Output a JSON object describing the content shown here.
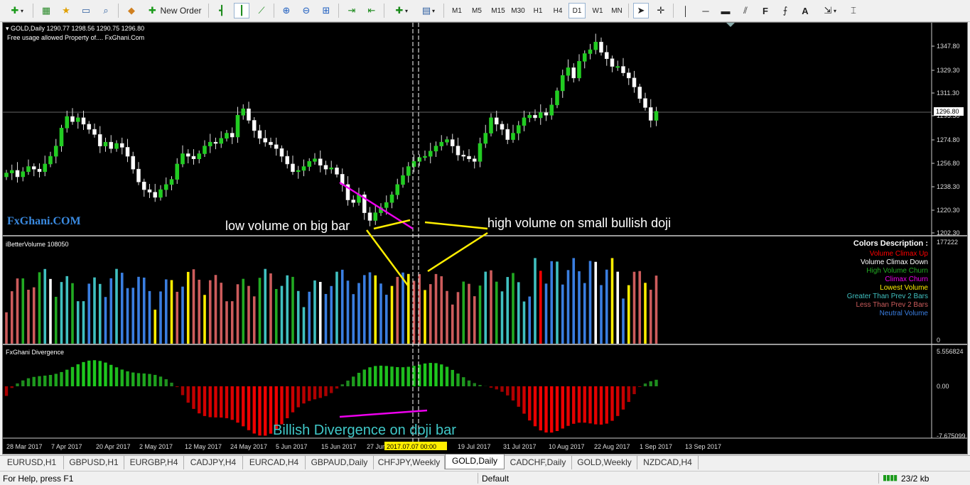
{
  "toolbar": {
    "new_order_label": "New Order",
    "timeframes": [
      "M1",
      "M5",
      "M15",
      "M30",
      "H1",
      "H4",
      "D1",
      "W1",
      "MN"
    ],
    "active_timeframe": "D1"
  },
  "chart": {
    "symbol_line": "GOLD,Daily  1290.77 1298.56 1290.75 1296.80",
    "usage_line": "Free usage allowed Property of.... FxGhani.Com",
    "watermark": "FxGhani.COM",
    "price_ticks": [
      "1347.80",
      "1329.30",
      "1311.30",
      "1293.30",
      "1274.80",
      "1256.80",
      "1238.30",
      "1220.30",
      "1202.30"
    ],
    "current_price": "1296.80",
    "volume_indicator": "iBetterVolume 108050",
    "volume_max": "177222",
    "volume_min": "0",
    "divergence_indicator": "FxGhani Divergence",
    "divergence_ticks": [
      "5.556824",
      "0.00",
      "-7.675099"
    ],
    "date_ticks": [
      "28 Mar 2017",
      "7 Apr 2017",
      "20 Apr 2017",
      "2 May 2017",
      "12 May 2017",
      "24 May 2017",
      "5 Jun 2017",
      "15 Jun 2017",
      "27 Jun 2017",
      "19 Jul 2017",
      "31 Jul 2017",
      "10 Aug 2017",
      "22 Aug 2017",
      "1 Sep 2017",
      "13 Sep 2017"
    ],
    "cursor_date": "2017.07.07 00:00",
    "annotations": {
      "low_volume": "low volume on big bar",
      "high_volume": "high volume on small bullish doji",
      "divergence": "Billish Divergence on doji bar"
    },
    "legend": {
      "title": "Colors Description :",
      "items": [
        {
          "label": "Volume Climax Up",
          "color": "#ff0000"
        },
        {
          "label": "Volume Climax Down",
          "color": "#ffffff"
        },
        {
          "label": "High Volume Churn",
          "color": "#22aa22"
        },
        {
          "label": "Climax Churn",
          "color": "#ee00ee"
        },
        {
          "label": "Lowest Volume",
          "color": "#ffee00"
        },
        {
          "label": "Greater Than Prev 2 Bars",
          "color": "#40c0c0"
        },
        {
          "label": "Less Than Prev 2 Bars",
          "color": "#cd5c5c"
        },
        {
          "label": "Neutral Volume",
          "color": "#3a7ee0"
        }
      ]
    }
  },
  "tabs": [
    "EURUSD,H1",
    "GBPUSD,H1",
    "EURGBP,H4",
    "CADJPY,H4",
    "EURCAD,H4",
    "GBPAUD,Daily",
    "CHFJPY,Weekly",
    "GOLD,Daily",
    "CADCHF,Daily",
    "GOLD,Weekly",
    "NZDCAD,H4"
  ],
  "active_tab": "GOLD,Daily",
  "status": {
    "help": "For Help, press F1",
    "profile": "Default",
    "traffic": "23/2 kb"
  }
}
